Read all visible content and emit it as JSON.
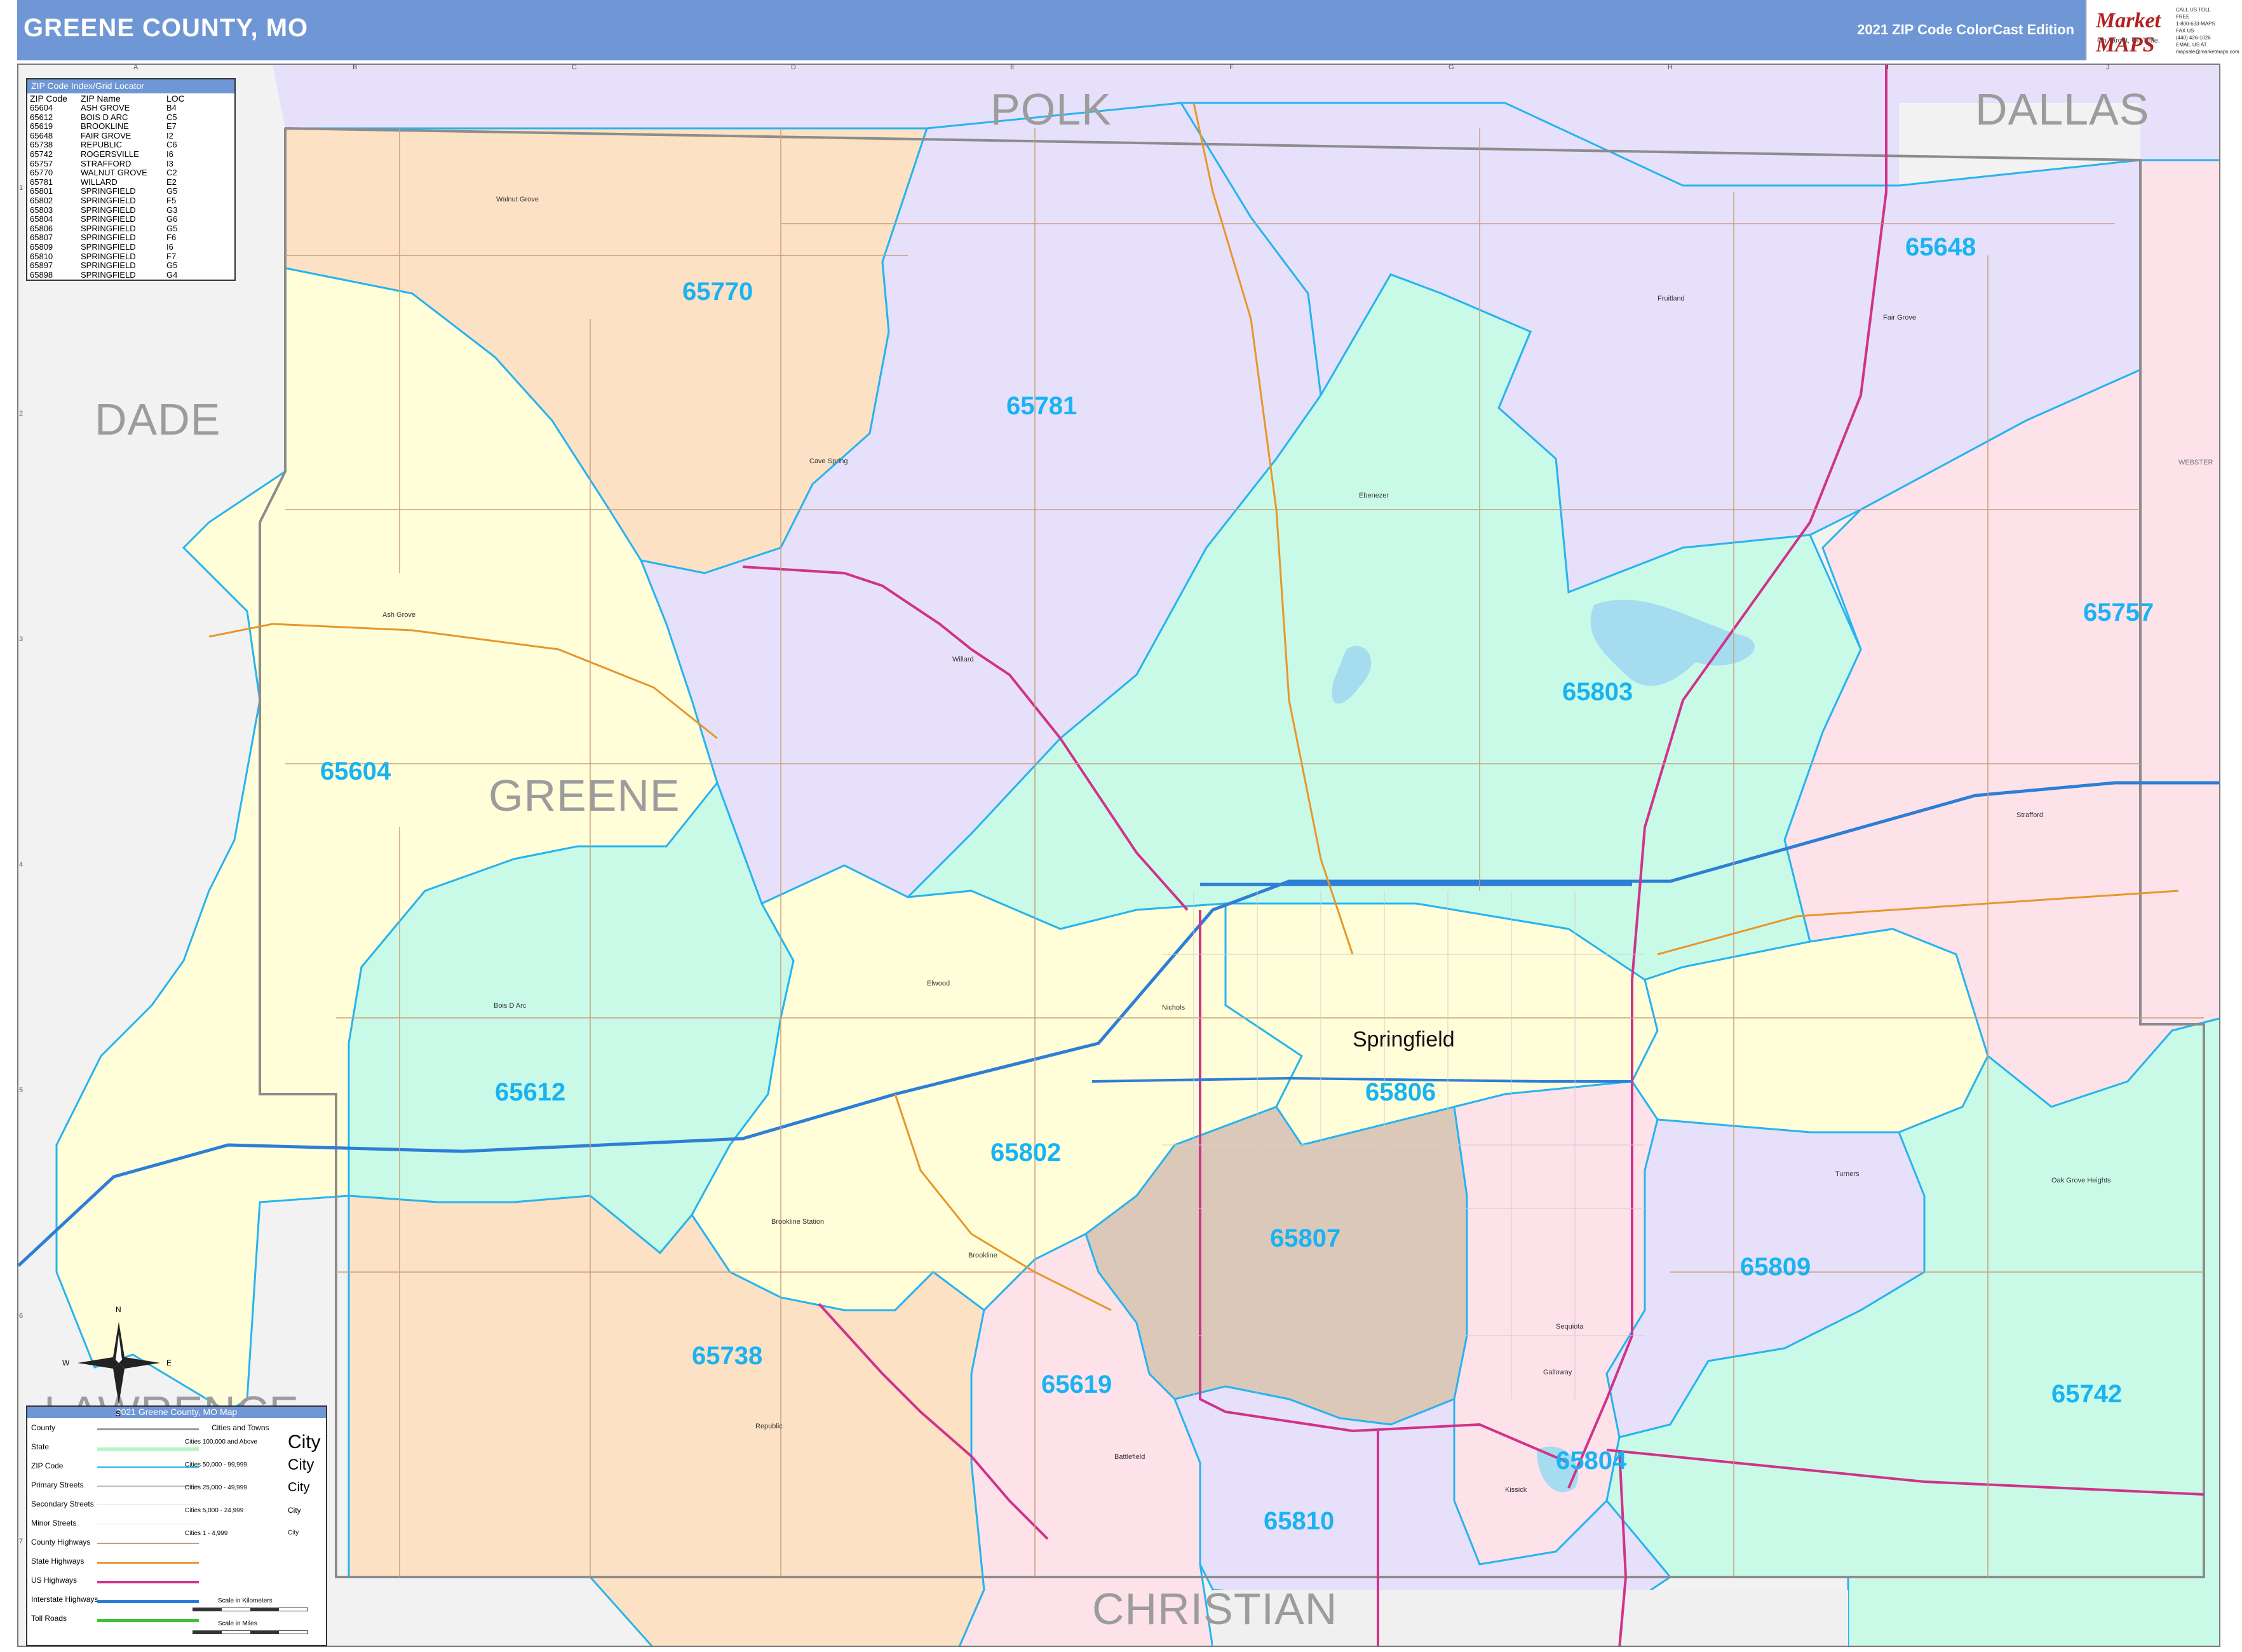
{
  "header": {
    "title": "GREENE COUNTY, MO",
    "edition": "2021 ZIP Code ColorCast Edition",
    "logo_text": "Market MAPS",
    "logo_tagline": "On Target, On Time.",
    "logo_sub": "America's Leading Source of Business Maps",
    "contact": [
      "CALL US TOLL FREE",
      "1-800-633-MAPS",
      "FAX US",
      "(440) 426-1026",
      "EMAIL US AT",
      "mapsale@marketmaps.com"
    ]
  },
  "index": {
    "title": "ZIP Code Index/Grid Locator",
    "headers": [
      "ZIP Code",
      "ZIP Name",
      "LOC"
    ],
    "rows": [
      [
        "65604",
        "ASH GROVE",
        "B4"
      ],
      [
        "65612",
        "BOIS D ARC",
        "C5"
      ],
      [
        "65619",
        "BROOKLINE",
        "E7"
      ],
      [
        "65648",
        "FAIR GROVE",
        "I2"
      ],
      [
        "65738",
        "REPUBLIC",
        "C6"
      ],
      [
        "65742",
        "ROGERSVILLE",
        "I6"
      ],
      [
        "65757",
        "STRAFFORD",
        "I3"
      ],
      [
        "65770",
        "WALNUT GROVE",
        "C2"
      ],
      [
        "65781",
        "WILLARD",
        "E2"
      ],
      [
        "65801",
        "SPRINGFIELD",
        "G5"
      ],
      [
        "65802",
        "SPRINGFIELD",
        "F5"
      ],
      [
        "65803",
        "SPRINGFIELD",
        "G3"
      ],
      [
        "65804",
        "SPRINGFIELD",
        "G6"
      ],
      [
        "65806",
        "SPRINGFIELD",
        "G5"
      ],
      [
        "65807",
        "SPRINGFIELD",
        "F6"
      ],
      [
        "65809",
        "SPRINGFIELD",
        "I6"
      ],
      [
        "65810",
        "SPRINGFIELD",
        "F7"
      ],
      [
        "65897",
        "SPRINGFIELD",
        "G5"
      ],
      [
        "65898",
        "SPRINGFIELD",
        "G4"
      ]
    ]
  },
  "legend": {
    "title": "2021 Greene County, MO Map",
    "items": [
      "County",
      "State",
      "ZIP Code",
      "Primary Streets",
      "Secondary Streets",
      "Minor Streets",
      "County Highways",
      "State Highways",
      "US Highways",
      "Interstate Highways",
      "Toll Roads"
    ],
    "cities_header": "Cities and Towns",
    "city_sizes": [
      "Cities 100,000 and Above",
      "Cities 50,000 - 99,999",
      "Cities 25,000 - 49,999",
      "Cities 5,000 - 24,999",
      "Cities 1 - 4,999"
    ],
    "city_samples": [
      "City",
      "City",
      "City",
      "City",
      "City"
    ],
    "scale_km": "Scale in Kilometers",
    "scale_mi": "Scale in Miles"
  },
  "counties": {
    "polk": "POLK",
    "dallas": "DALLAS",
    "dade": "DADE",
    "greene": "GREENE",
    "lawrence": "LAWRENCE",
    "christian": "CHRISTIAN",
    "webster": "WEBSTER"
  },
  "zips": {
    "z65770": "65770",
    "z65781": "65781",
    "z65648": "65648",
    "z65757": "65757",
    "z65803": "65803",
    "z65604": "65604",
    "z65612": "65612",
    "z65802": "65802",
    "z65806": "65806",
    "z65807": "65807",
    "z65809": "65809",
    "z65738": "65738",
    "z65619": "65619",
    "z65742": "65742",
    "z65804": "65804",
    "z65810": "65810"
  },
  "towns": {
    "springfield": "Springfield",
    "walnut_grove": "Walnut Grove",
    "cave_spring": "Cave Spring",
    "ash_grove": "Ash Grove",
    "willard": "Willard",
    "ebenezer": "Ebenezer",
    "fruitland": "Fruitland",
    "fair_grove": "Fair Grove",
    "strafford": "Strafford",
    "bois_d_arc": "Bois D Arc",
    "elwood": "Elwood",
    "nichols": "Nichols",
    "brookline_station": "Brookline Station",
    "brookline": "Brookline",
    "republic": "Republic",
    "battlefield": "Battlefield",
    "sequiota": "Sequiota",
    "galloway": "Galloway",
    "kissick": "Kissick",
    "oak_grove_heights": "Oak Grove Heights",
    "turners": "Turners"
  },
  "grid": {
    "cols": [
      "A",
      "B",
      "C",
      "D",
      "E",
      "F",
      "G",
      "H",
      "I",
      "J"
    ],
    "rows": [
      "1",
      "2",
      "3",
      "4",
      "5",
      "6",
      "7"
    ]
  },
  "compass": {
    "n": "N",
    "s": "S",
    "e": "E",
    "w": "W"
  },
  "colors": {
    "header": "#6f97d6",
    "zip_label": "#1ab3f2",
    "peach": "#fde1c4",
    "lavender": "#e7e0fb",
    "mint": "#c9fae8",
    "yellow": "#fffed9",
    "pink": "#fde2ea",
    "tan": "#dcc8b8",
    "grey": "#f0f0f0"
  }
}
